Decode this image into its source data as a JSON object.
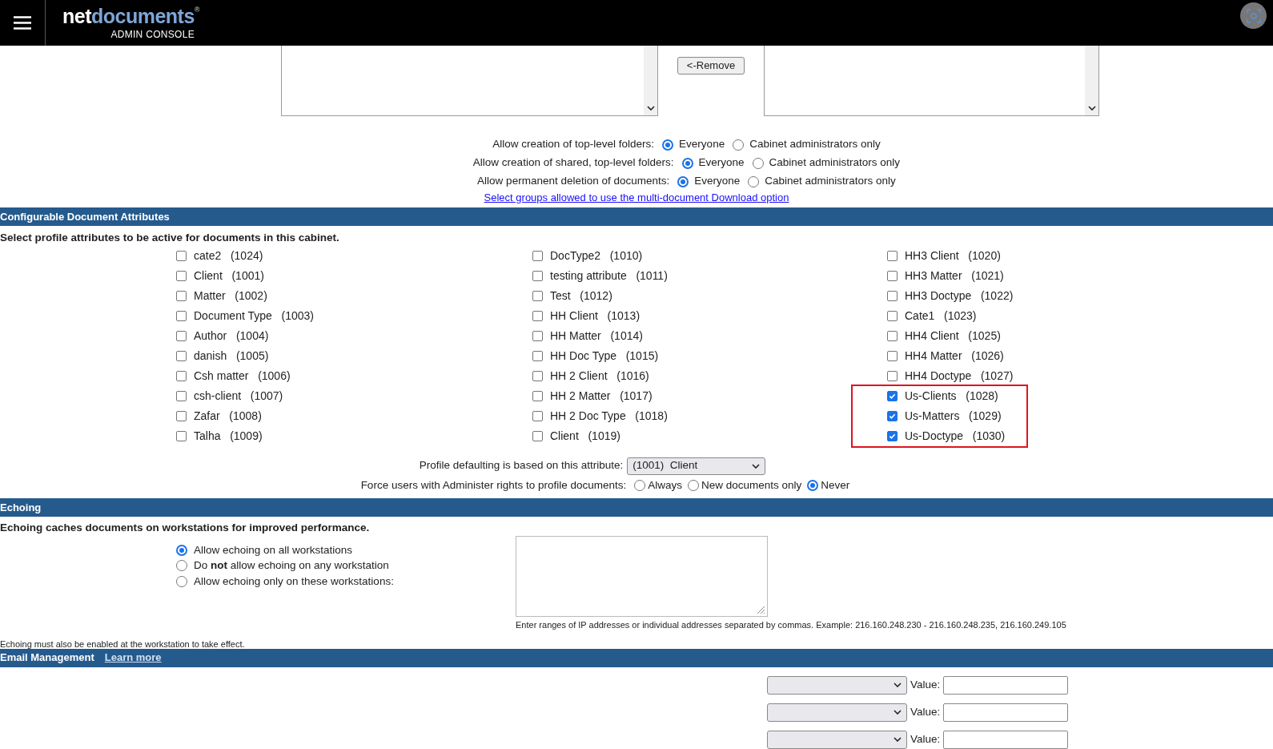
{
  "header": {
    "brand_first": "net",
    "brand_second": "documents",
    "brand_mark": "®",
    "subtitle": "ADMIN CONSOLE"
  },
  "group_lists": {
    "remove_button": "<-Remove"
  },
  "permissions": [
    {
      "label": "Allow creation of top-level folders:",
      "options": [
        {
          "label": "Everyone",
          "selected": true
        },
        {
          "label": "Cabinet administrators only",
          "selected": false
        }
      ]
    },
    {
      "label": "Allow creation of shared, top-level folders:",
      "options": [
        {
          "label": "Everyone",
          "selected": true
        },
        {
          "label": "Cabinet administrators only",
          "selected": false
        }
      ]
    },
    {
      "label": "Allow permanent deletion of documents:",
      "options": [
        {
          "label": "Everyone",
          "selected": true
        },
        {
          "label": "Cabinet administrators only",
          "selected": false
        }
      ]
    }
  ],
  "download_link": "Select groups allowed to use the multi-document Download option",
  "attributes": {
    "title": "Configurable Document Attributes",
    "intro": "Select profile attributes to be active for documents in this cabinet.",
    "columns": [
      [
        {
          "name": "cate2",
          "code": "(1024)",
          "checked": false,
          "highlighted": false
        },
        {
          "name": "Client",
          "code": "(1001)",
          "checked": false,
          "highlighted": false
        },
        {
          "name": "Matter",
          "code": "(1002)",
          "checked": false,
          "highlighted": false
        },
        {
          "name": "Document Type",
          "code": "(1003)",
          "checked": false,
          "highlighted": false
        },
        {
          "name": "Author",
          "code": "(1004)",
          "checked": false,
          "highlighted": false
        },
        {
          "name": "danish",
          "code": "(1005)",
          "checked": false,
          "highlighted": false
        },
        {
          "name": "Csh matter",
          "code": "(1006)",
          "checked": false,
          "highlighted": false
        },
        {
          "name": "csh-client",
          "code": "(1007)",
          "checked": false,
          "highlighted": false
        },
        {
          "name": "Zafar",
          "code": "(1008)",
          "checked": false,
          "highlighted": false
        },
        {
          "name": "Talha",
          "code": "(1009)",
          "checked": false,
          "highlighted": false
        }
      ],
      [
        {
          "name": "DocType2",
          "code": "(1010)",
          "checked": false,
          "highlighted": false
        },
        {
          "name": "testing attribute",
          "code": "(1011)",
          "checked": false,
          "highlighted": false
        },
        {
          "name": "Test",
          "code": "(1012)",
          "checked": false,
          "highlighted": false
        },
        {
          "name": "HH Client",
          "code": "(1013)",
          "checked": false,
          "highlighted": false
        },
        {
          "name": "HH Matter",
          "code": "(1014)",
          "checked": false,
          "highlighted": false
        },
        {
          "name": "HH Doc Type",
          "code": "(1015)",
          "checked": false,
          "highlighted": false
        },
        {
          "name": "HH 2 Client",
          "code": "(1016)",
          "checked": false,
          "highlighted": false
        },
        {
          "name": "HH 2 Matter",
          "code": "(1017)",
          "checked": false,
          "highlighted": false
        },
        {
          "name": "HH 2 Doc Type",
          "code": "(1018)",
          "checked": false,
          "highlighted": false
        },
        {
          "name": "Client",
          "code": "(1019)",
          "checked": false,
          "highlighted": false
        }
      ],
      [
        {
          "name": "HH3 Client",
          "code": "(1020)",
          "checked": false,
          "highlighted": false
        },
        {
          "name": "HH3 Matter",
          "code": "(1021)",
          "checked": false,
          "highlighted": false
        },
        {
          "name": "HH3 Doctype",
          "code": "(1022)",
          "checked": false,
          "highlighted": false
        },
        {
          "name": "Cate1",
          "code": "(1023)",
          "checked": false,
          "highlighted": false
        },
        {
          "name": "HH4 Client",
          "code": "(1025)",
          "checked": false,
          "highlighted": false
        },
        {
          "name": "HH4 Matter",
          "code": "(1026)",
          "checked": false,
          "highlighted": false
        },
        {
          "name": "HH4 Doctype",
          "code": "(1027)",
          "checked": false,
          "highlighted": false
        },
        {
          "name": "Us-Clients",
          "code": "(1028)",
          "checked": true,
          "highlighted": true
        },
        {
          "name": "Us-Matters",
          "code": "(1029)",
          "checked": true,
          "highlighted": true
        },
        {
          "name": "Us-Doctype",
          "code": "(1030)",
          "checked": true,
          "highlighted": true
        }
      ]
    ],
    "default_label": "Profile defaulting is based on this attribute:",
    "default_value": "(1001)  Client",
    "force_label": "Force users with Administer rights to profile documents:",
    "force_options": [
      {
        "label": "Always",
        "selected": false
      },
      {
        "label": "New documents only",
        "selected": false
      },
      {
        "label": "Never",
        "selected": true
      }
    ]
  },
  "echoing": {
    "title": "Echoing",
    "intro": "Echoing caches documents on workstations for improved performance.",
    "options": [
      {
        "label": "Allow echoing on all workstations",
        "selected": true
      },
      {
        "label": "Do **not** allow echoing on any workstation",
        "selected": false
      },
      {
        "label": "Allow echoing only on these workstations:",
        "selected": false
      }
    ],
    "hint": "Enter ranges of IP addresses or individual addresses separated by commas. Example: 216.160.248.230 - 216.160.248.235, 216.160.249.105",
    "note": "Echoing must also be enabled at the workstation to take effect."
  },
  "email": {
    "title": "Email Management",
    "link": "Learn more",
    "rows": [
      {
        "label": "Value:"
      },
      {
        "label": "Value:"
      },
      {
        "label": "Value:"
      }
    ]
  }
}
